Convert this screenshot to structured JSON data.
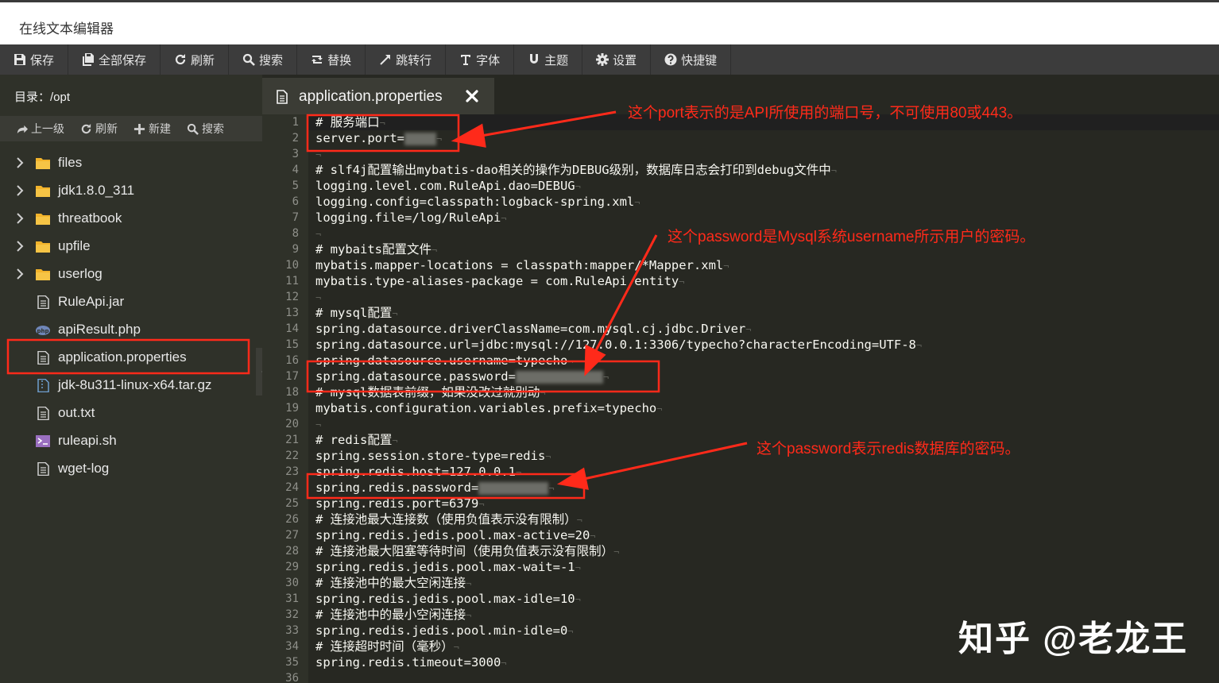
{
  "window": {
    "title": "在线文本编辑器"
  },
  "toolbar": {
    "items": [
      {
        "label": "保存",
        "icon": "save-icon"
      },
      {
        "label": "全部保存",
        "icon": "save-all-icon"
      },
      {
        "label": "刷新",
        "icon": "refresh-icon"
      },
      {
        "label": "搜索",
        "icon": "search-icon"
      },
      {
        "label": "替换",
        "icon": "replace-icon"
      },
      {
        "label": "跳转行",
        "icon": "goto-line-icon"
      },
      {
        "label": "字体",
        "icon": "font-icon"
      },
      {
        "label": "主题",
        "icon": "theme-icon"
      },
      {
        "label": "设置",
        "icon": "gear-icon"
      },
      {
        "label": "快捷键",
        "icon": "help-icon"
      }
    ]
  },
  "sidebar": {
    "dir_label": "目录：/opt",
    "actions": [
      {
        "label": "上一级",
        "icon": "up-level-icon"
      },
      {
        "label": "刷新",
        "icon": "refresh-icon"
      },
      {
        "label": "新建",
        "icon": "plus-icon"
      },
      {
        "label": "搜索",
        "icon": "search-icon"
      }
    ],
    "tree": [
      {
        "label": "files",
        "type": "folder"
      },
      {
        "label": "jdk1.8.0_311",
        "type": "folder"
      },
      {
        "label": "threatbook",
        "type": "folder"
      },
      {
        "label": "upfile",
        "type": "folder"
      },
      {
        "label": "userlog",
        "type": "folder"
      },
      {
        "label": "RuleApi.jar",
        "type": "file"
      },
      {
        "label": "apiResult.php",
        "type": "php"
      },
      {
        "label": "application.properties",
        "type": "file",
        "selected": true
      },
      {
        "label": "jdk-8u311-linux-x64.tar.gz",
        "type": "archive"
      },
      {
        "label": "out.txt",
        "type": "file"
      },
      {
        "label": "ruleapi.sh",
        "type": "shell"
      },
      {
        "label": "wget-log",
        "type": "file"
      }
    ]
  },
  "editor": {
    "tab_name": "application.properties",
    "lines": [
      "# 服务端口",
      "server.port=",
      "",
      "# slf4j配置输出mybatis-dao相关的操作为DEBUG级别，数据库日志会打印到debug文件中",
      "logging.level.com.RuleApi.dao=DEBUG",
      "logging.config=classpath:logback-spring.xml",
      "logging.file=/log/RuleApi",
      "",
      "# mybaits配置文件",
      "mybatis.mapper-locations = classpath:mapper/*Mapper.xml",
      "mybatis.type-aliases-package = com.RuleApi.entity",
      "",
      "# mysql配置",
      "spring.datasource.driverClassName=com.mysql.cj.jdbc.Driver",
      "spring.datasource.url=jdbc:mysql://127.0.0.1:3306/typecho?characterEncoding=UTF-8",
      "spring.datasource.username=typecho",
      "spring.datasource.password=",
      "# mysql数据表前缀，如果没改过就别动",
      "mybatis.configuration.variables.prefix=typecho",
      "",
      "# redis配置",
      "spring.session.store-type=redis",
      "spring.redis.host=127.0.0.1",
      "spring.redis.password=",
      "spring.redis.port=6379",
      "# 连接池最大连接数（使用负值表示没有限制）",
      "spring.redis.jedis.pool.max-active=20",
      "# 连接池最大阻塞等待时间（使用负值表示没有限制）",
      "spring.redis.jedis.pool.max-wait=-1",
      "# 连接池中的最大空闲连接",
      "spring.redis.jedis.pool.max-idle=10",
      "# 连接池中的最小空闲连接",
      "spring.redis.jedis.pool.min-idle=0",
      "# 连接超时时间（毫秒）",
      "spring.redis.timeout=3000",
      ""
    ],
    "line_numbers": [
      "1",
      "2",
      "3",
      "4",
      "5",
      "6",
      "7",
      "8",
      "9",
      "10",
      "11",
      "12",
      "13",
      "14",
      "15",
      "16",
      "17",
      "18",
      "19",
      "20",
      "21",
      "22",
      "23",
      "24",
      "25",
      "26",
      "27",
      "28",
      "29",
      "30",
      "31",
      "32",
      "33",
      "34",
      "35",
      "36"
    ]
  },
  "annotations": {
    "port_note": "这个port表示的是API所使用的端口号，不可使用80或443。",
    "mysql_note": "这个password是Mysql系统username所示用户的密码。",
    "redis_note": "这个password表示redis数据库的密码。",
    "color": "#ff2a1a"
  },
  "watermark": "知乎 @老龙王"
}
